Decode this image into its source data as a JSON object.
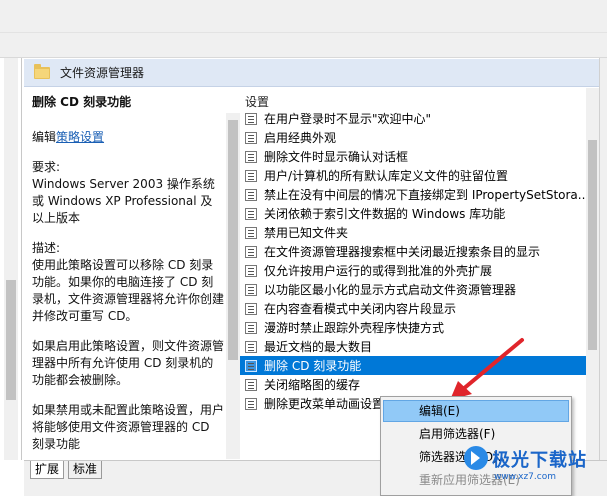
{
  "header": {
    "title": "文件资源管理器"
  },
  "description": {
    "title": "删除 CD 刻录功能",
    "edit_prefix": "编辑",
    "edit_link": "策略设置",
    "requirements_label": "要求:",
    "requirements_text": "Windows Server 2003 操作系统或 Windows XP Professional 及以上版本",
    "desc_label": "描述:",
    "desc_text": "使用此策略设置可以移除 CD 刻录功能。如果你的电脑连接了 CD 刻录机，文件资源管理器将允许你创建并修改可重写 CD。",
    "enabled_text": "如果启用此策略设置，则文件资源管理器中所有允许使用 CD 刻录机的功能都会被删除。",
    "disabled_text": "如果禁用或未配置此策略设置，用户将能够使用文件资源管理器的 CD 刻录功能"
  },
  "list": {
    "header": "设置",
    "items": [
      "在用户登录时不显示\"欢迎中心\"",
      "启用经典外观",
      "删除文件时显示确认对话框",
      "用户/计算机的所有默认库定义文件的驻留位置",
      "禁止在没有中间层的情况下直接绑定到 IPropertySetStora...",
      "关闭依赖于索引文件数据的 Windows 库功能",
      "禁用已知文件夹",
      "在文件资源管理器搜索框中关闭最近搜索条目的显示",
      "仅允许按用户运行的或得到批准的外壳扩展",
      "以功能区最小化的显示方式启动文件资源管理器",
      "在内容查看模式中关闭内容片段显示",
      "漫游时禁止跟踪外壳程序快捷方式",
      "最近文档的最大数目",
      "删除 CD 刻录功能",
      "关闭缩略图的缓存",
      "删除更改菜单动画设置的..."
    ],
    "selected_index": 13
  },
  "context_menu": {
    "items": [
      "编辑(E)",
      "启用筛选器(F)",
      "筛选器选项(O)...",
      "重新应用筛选器(E)"
    ],
    "highlighted_index": 0
  },
  "tabs": [
    "扩展",
    "标准"
  ],
  "watermark": {
    "text": "极光下载站",
    "url": "www.xz7.com"
  },
  "colors": {
    "selection": "#0078d7",
    "menu_highlight": "#91c9f7",
    "arrow": "#e0252b",
    "header_bg": "#dfe8f5"
  }
}
